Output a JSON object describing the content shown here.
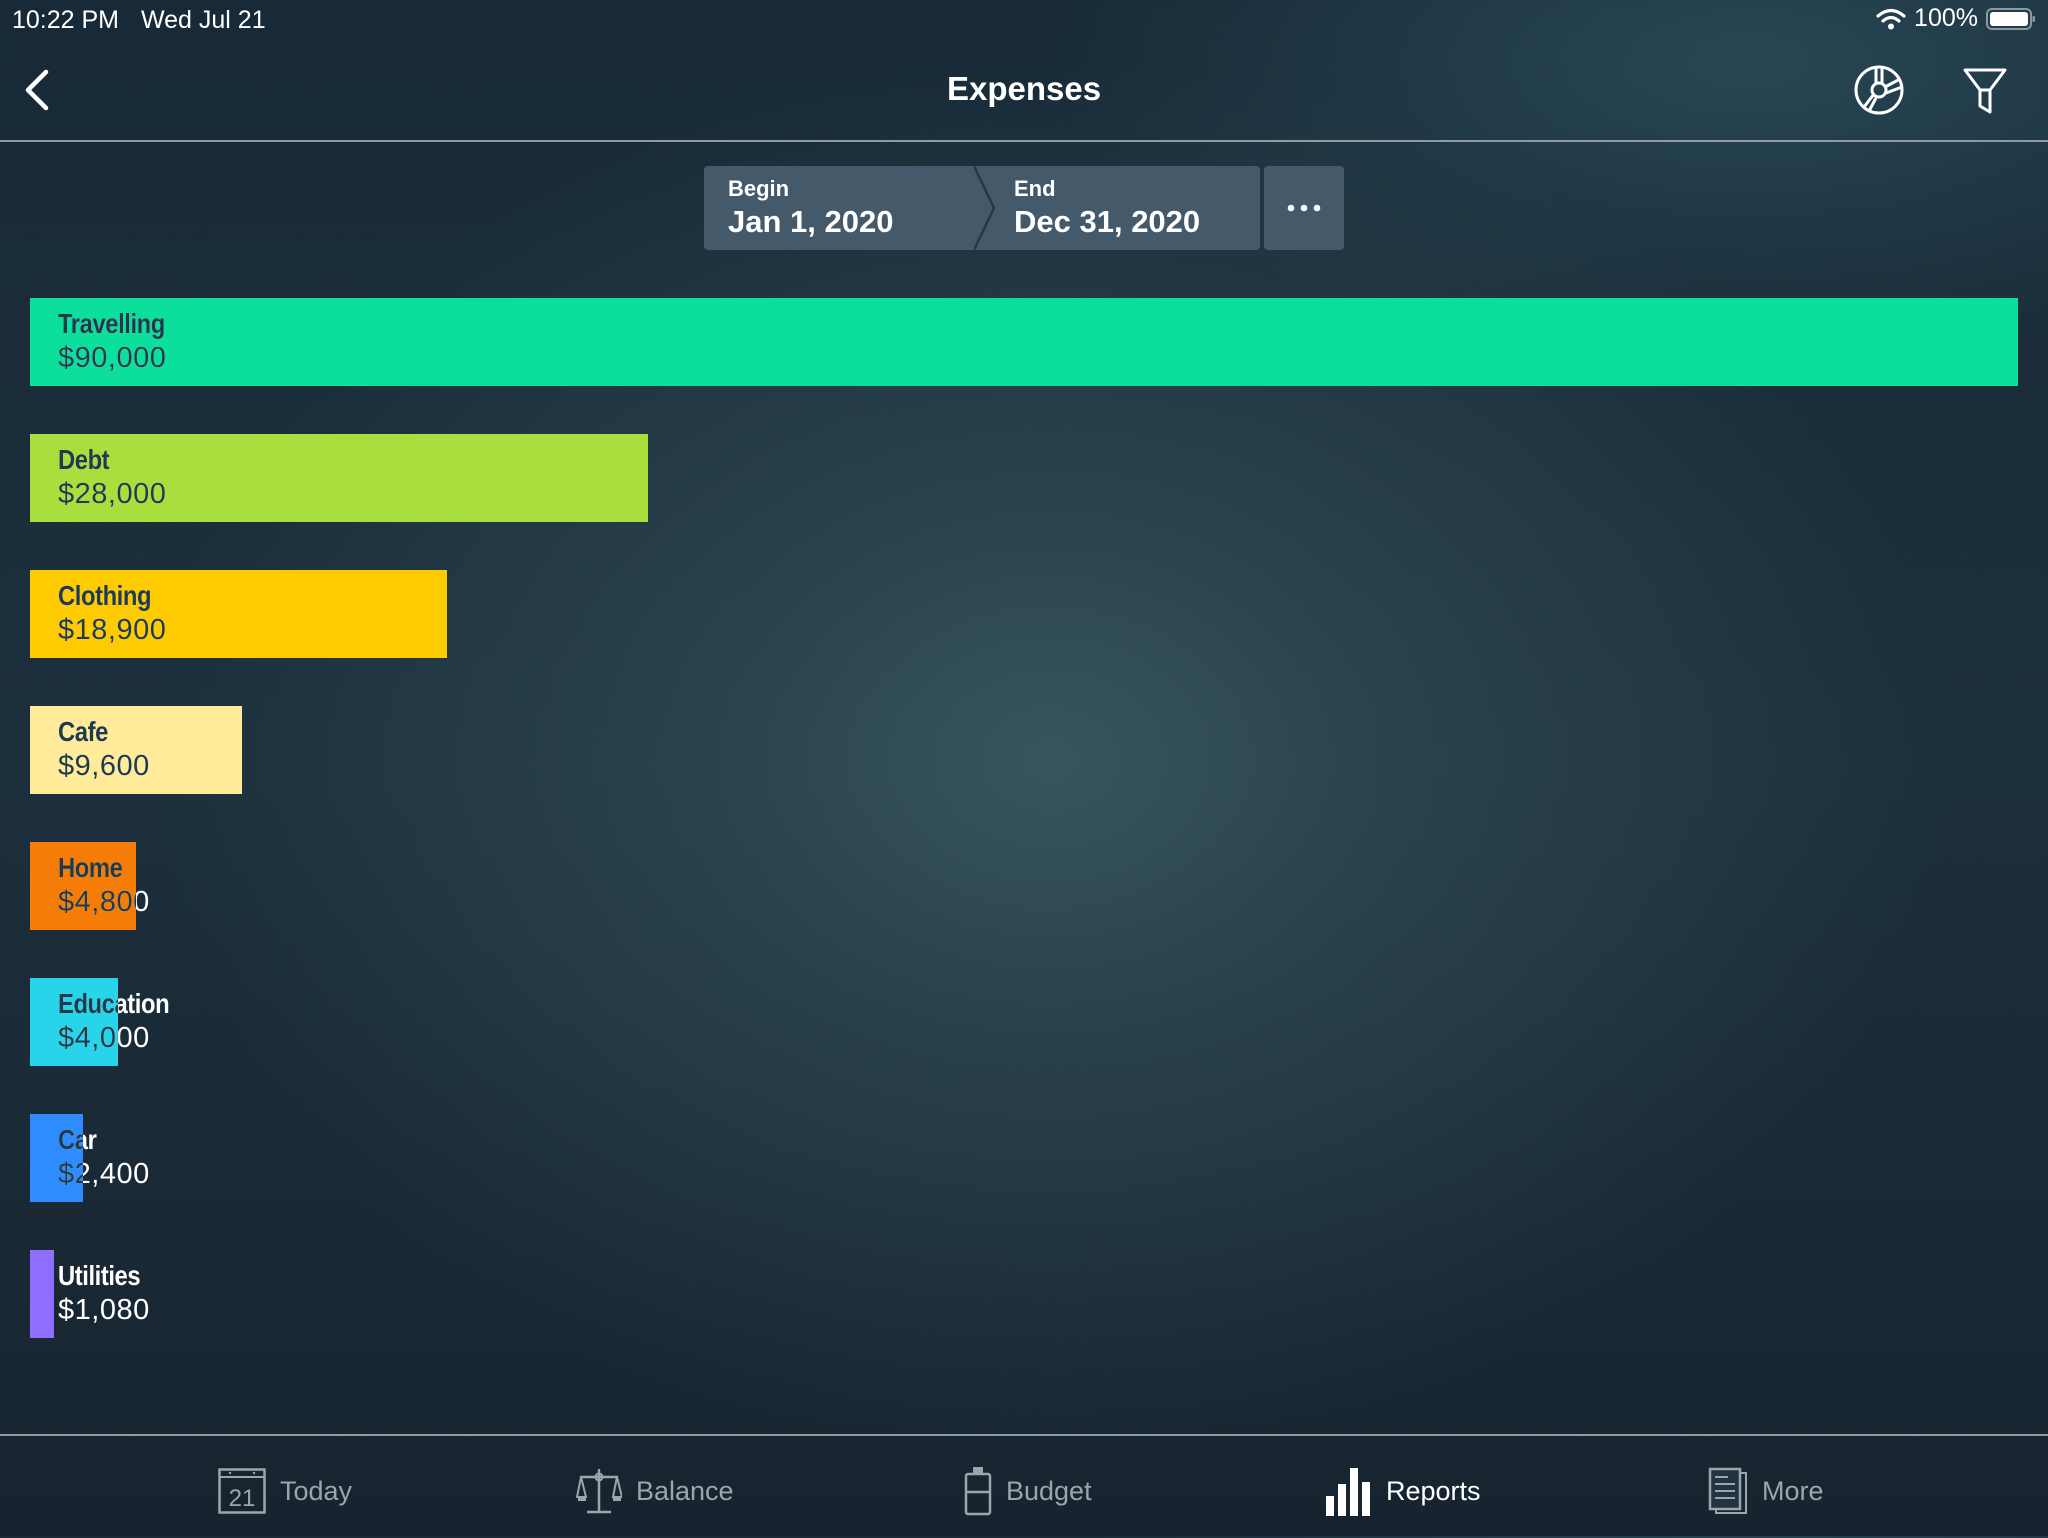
{
  "status_bar": {
    "time": "10:22 PM",
    "date": "Wed Jul 21",
    "battery": "100%",
    "wifi_icon": "wifi-icon",
    "battery_icon": "battery-icon"
  },
  "nav": {
    "title": "Expenses",
    "back_icon": "chevron-left-icon",
    "chart_type_icon": "pie-chart-icon",
    "filter_icon": "filter-icon"
  },
  "date_range": {
    "begin_label": "Begin",
    "begin_value": "Jan 1, 2020",
    "end_label": "End",
    "end_value": "Dec 31, 2020",
    "more_icon": "ellipsis-icon"
  },
  "chart_data": {
    "type": "bar",
    "orientation": "horizontal",
    "title": "Expenses",
    "xlabel": "",
    "ylabel": "",
    "xlim": [
      0,
      90000
    ],
    "grid": false,
    "legend": "none",
    "categories": [
      "Travelling",
      "Debt",
      "Clothing",
      "Cafe",
      "Home",
      "Education",
      "Car",
      "Utilities"
    ],
    "values": [
      90000,
      28000,
      18900,
      9600,
      4800,
      4000,
      2400,
      1080
    ],
    "value_labels": [
      "$90,000",
      "$28,000",
      "$18,900",
      "$9,600",
      "$4,800",
      "$4,000",
      "$2,400",
      "$1,080"
    ],
    "colors": [
      "#0bdf9b",
      "#a9df3c",
      "#fecb00",
      "#ffeb99",
      "#f57c06",
      "#27d4ea",
      "#2e8cff",
      "#8f6fff"
    ]
  },
  "tab_bar": {
    "items": [
      {
        "label": "Today",
        "icon": "calendar-icon",
        "icon_text": "21",
        "active": false
      },
      {
        "label": "Balance",
        "icon": "scale-icon",
        "active": false
      },
      {
        "label": "Budget",
        "icon": "jar-icon",
        "active": false
      },
      {
        "label": "Reports",
        "icon": "bar-chart-icon",
        "active": true
      },
      {
        "label": "More",
        "icon": "documents-icon",
        "active": false
      }
    ]
  }
}
